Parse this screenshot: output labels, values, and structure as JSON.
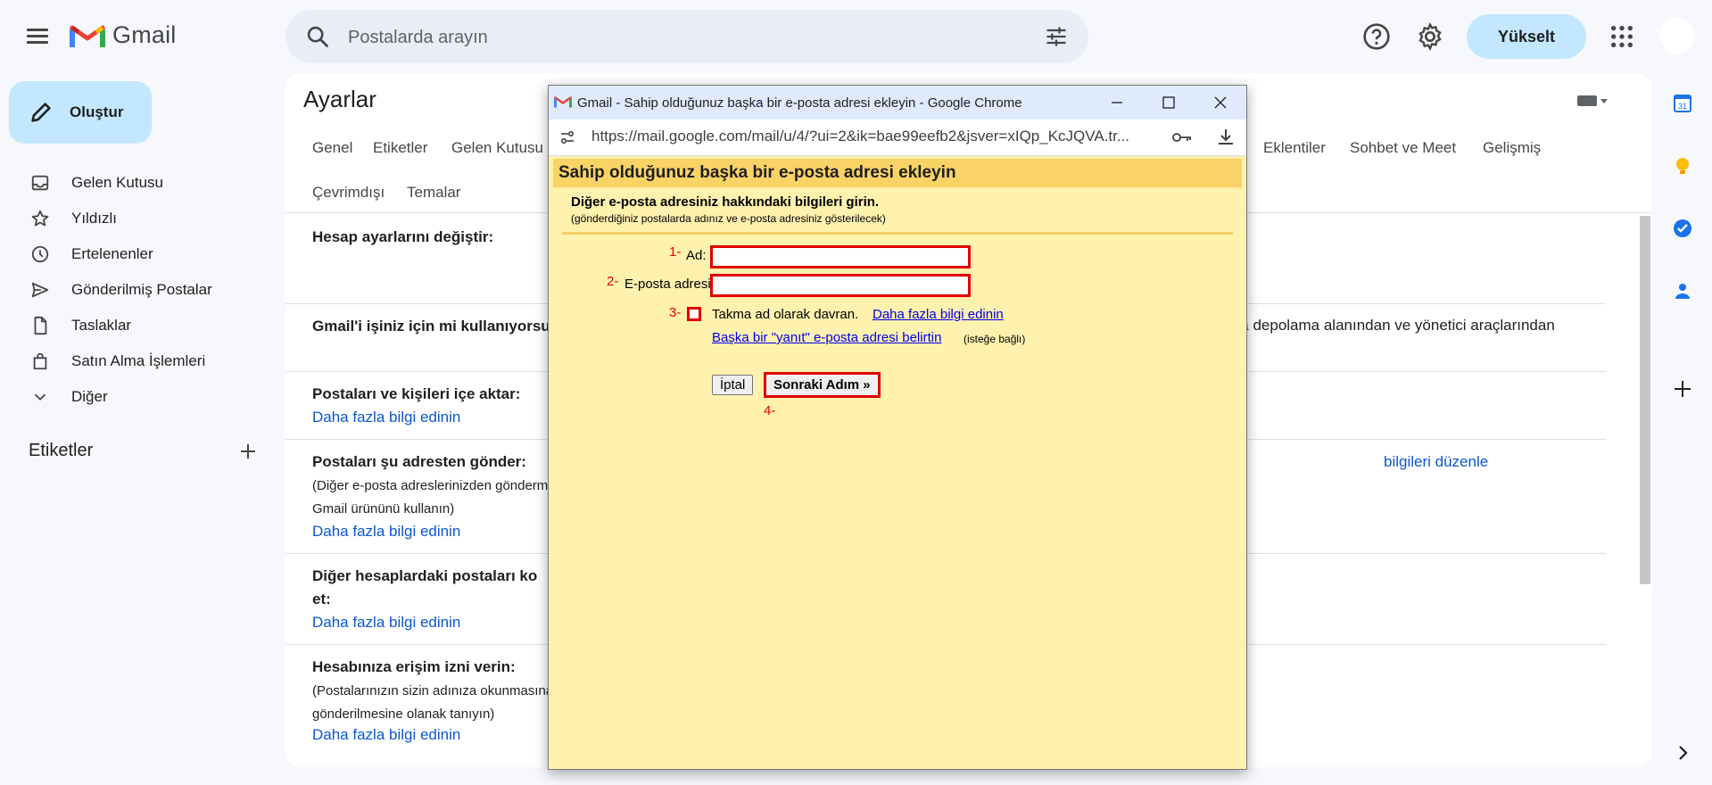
{
  "header": {
    "app_name": "Gmail",
    "search_placeholder": "Postalarda arayın",
    "upgrade_label": "Yükselt"
  },
  "sidebar": {
    "compose_label": "Oluştur",
    "items": [
      {
        "label": "Gelen Kutusu",
        "icon": "inbox-icon"
      },
      {
        "label": "Yıldızlı",
        "icon": "star-icon"
      },
      {
        "label": "Ertelenenler",
        "icon": "clock-icon"
      },
      {
        "label": "Gönderilmiş Postalar",
        "icon": "send-icon"
      },
      {
        "label": "Taslaklar",
        "icon": "draft-icon"
      },
      {
        "label": "Satın Alma İşlemleri",
        "icon": "shopping-bag-icon"
      },
      {
        "label": "Diğer",
        "icon": "chevron-down-icon"
      }
    ],
    "labels_heading": "Etiketler"
  },
  "settings": {
    "title": "Ayarlar",
    "tabs_row1": [
      "Genel",
      "Etiketler",
      "Gelen Kutusu",
      "Eklentiler",
      "Sohbet ve Meet",
      "Gelişmiş"
    ],
    "tabs_row2": [
      "Çevrimdışı",
      "Temalar"
    ],
    "sections": {
      "account": {
        "title": "Hesap ayarlarını değiştir:"
      },
      "business": {
        "title": "Gmail'i işiniz için mi kullanıyorsu",
        "right_text": "zla depolama alanından ve yönetici araçlarından"
      },
      "import": {
        "title": "Postaları ve kişileri içe aktar:",
        "link": "Daha fazla bilgi edinin"
      },
      "sendas": {
        "title": "Postaları şu adresten gönder:",
        "sub1": "(Diğer e-posta adreslerinizden gönderm",
        "sub2": "Gmail ürününü kullanın)",
        "link": "Daha fazla bilgi edinin",
        "right_link": "bilgileri düzenle"
      },
      "check": {
        "title1": "Diğer hesaplardaki postaları ko",
        "title2": "et:",
        "link": "Daha fazla bilgi edinin"
      },
      "grant": {
        "title": "Hesabınıza erişim izni verin:",
        "sub1": "(Postalarınızın sizin adınıza okunmasına",
        "sub2": "gönderilmesine olanak tanıyın)",
        "link": "Daha fazla bilgi edinin"
      }
    }
  },
  "popup": {
    "window_title": "Gmail - Sahip olduğunuz başka bir e-posta adresi ekleyin - Google Chrome",
    "url": "https://mail.google.com/mail/u/4/?ui=2&ik=bae99eefb2&jsver=xIQp_KcJQVA.tr...",
    "heading": "Sahip olduğunuz başka bir e-posta adresi ekleyin",
    "instruction": "Diğer e-posta adresiniz hakkındaki bilgileri girin.",
    "instruction_sub": "(gönderdiğiniz postalarda adınız ve e-posta adresiniz gösterilecek)",
    "step1": "1-",
    "step2": "2-",
    "step3": "3-",
    "step4": "4-",
    "name_label": "Ad:",
    "name_value": "",
    "email_label": "E-posta adresi:",
    "email_value": "",
    "alias_text": "Takma ad olarak davran.",
    "alias_link": "Daha fazla bilgi edinin",
    "reply_link": "Başka bir \"yanıt\" e-posta adresi belirtin",
    "optional": "(isteğe bağlı)",
    "cancel_label": "İptal",
    "next_label": "Sonraki Adım »"
  },
  "colors": {
    "accent": "#0b57d0",
    "compose_bg": "#c2e7ff",
    "highlight_red": "#e00000",
    "popup_bg": "#fff1ae",
    "popup_header": "#f9d366"
  }
}
